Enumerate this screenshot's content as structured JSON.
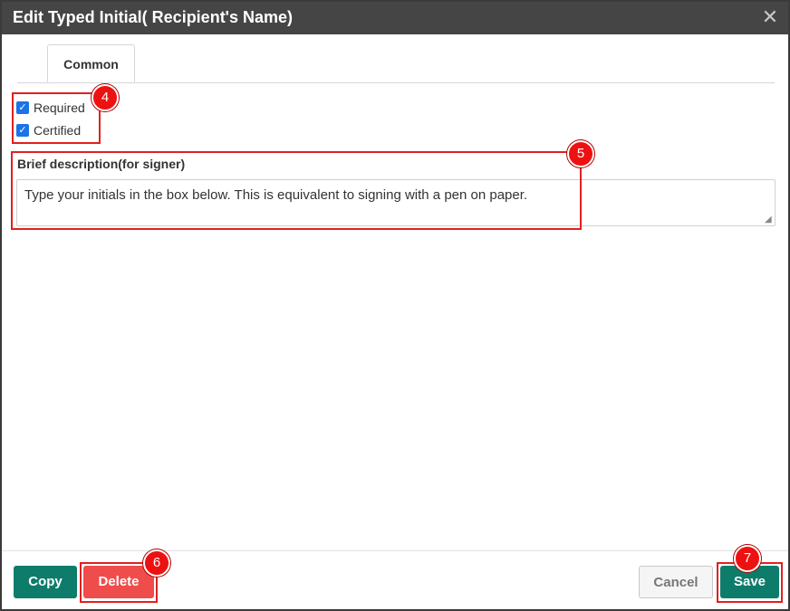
{
  "dialog": {
    "title": "Edit Typed Initial( Recipient's Name)",
    "close_glyph": "✕"
  },
  "tabs": [
    {
      "label": "Common",
      "active": true
    }
  ],
  "options": {
    "required": {
      "label": "Required",
      "checked": true
    },
    "certified": {
      "label": "Certified",
      "checked": true
    }
  },
  "description": {
    "label": "Brief description(for signer)",
    "value": "Type your initials in the box below. This is equivalent to signing with a pen on paper."
  },
  "footer": {
    "copy_label": "Copy",
    "delete_label": "Delete",
    "cancel_label": "Cancel",
    "save_label": "Save"
  },
  "annotations": [
    {
      "number": "4"
    },
    {
      "number": "5"
    },
    {
      "number": "6"
    },
    {
      "number": "7"
    }
  ],
  "colors": {
    "titlebar": "#454545",
    "primary_button": "#0e7c6b",
    "danger_button": "#ef4c4c",
    "annotation_red": "#e02020",
    "checkbox": "#1a73e8"
  }
}
